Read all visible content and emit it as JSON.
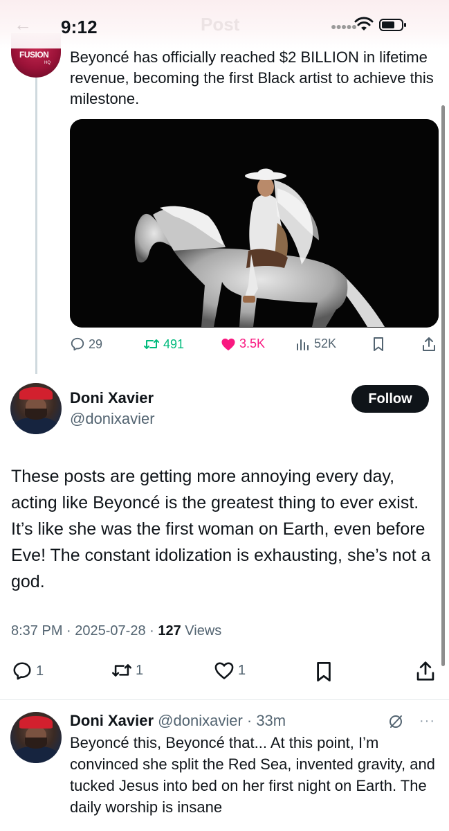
{
  "status_bar": {
    "time": "9:12",
    "background_title": "Post"
  },
  "parent_post": {
    "avatar_text": "FUSION",
    "avatar_subtext": "HQ",
    "text": "Beyoncé has officially reached $2 BILLION in lifetime revenue, becoming the first Black artist to achieve this milestone.",
    "actions": {
      "replies": "29",
      "reposts": "491",
      "likes": "3.5K",
      "views": "52K"
    },
    "colors": {
      "repost": "#00ba7c",
      "like": "#f91880",
      "neutral": "#536471"
    }
  },
  "main_post": {
    "name": "Doni Xavier",
    "handle": "@donixavier",
    "follow_label": "Follow",
    "text": "These posts are getting more annoying every day, acting like Beyoncé is the greatest thing to ever exist. It’s like she was the first woman on Earth, even before Eve! The constant idolization is exhausting, she’s not a god.",
    "meta_time": "8:37 PM · 2025-07-28 · ",
    "meta_views_count": "127",
    "meta_views_label": " Views",
    "actions": {
      "replies": "1",
      "reposts": "1",
      "likes": "1"
    }
  },
  "reply_post": {
    "name": "Doni Xavier",
    "handle_time": " @donixavier · 33m",
    "text": "Beyoncé this, Beyoncé that... At this point, I’m convinced she split the Red Sea, invented gravity, and tucked Jesus into bed on her first night on Earth. The daily worship is insane",
    "more": "···"
  },
  "icons": [
    "back-arrow-icon",
    "signal-icon",
    "wifi-icon",
    "battery-icon",
    "reply-icon",
    "repost-icon",
    "like-icon",
    "views-icon",
    "bookmark-icon",
    "share-icon",
    "grok-icon",
    "more-icon"
  ]
}
